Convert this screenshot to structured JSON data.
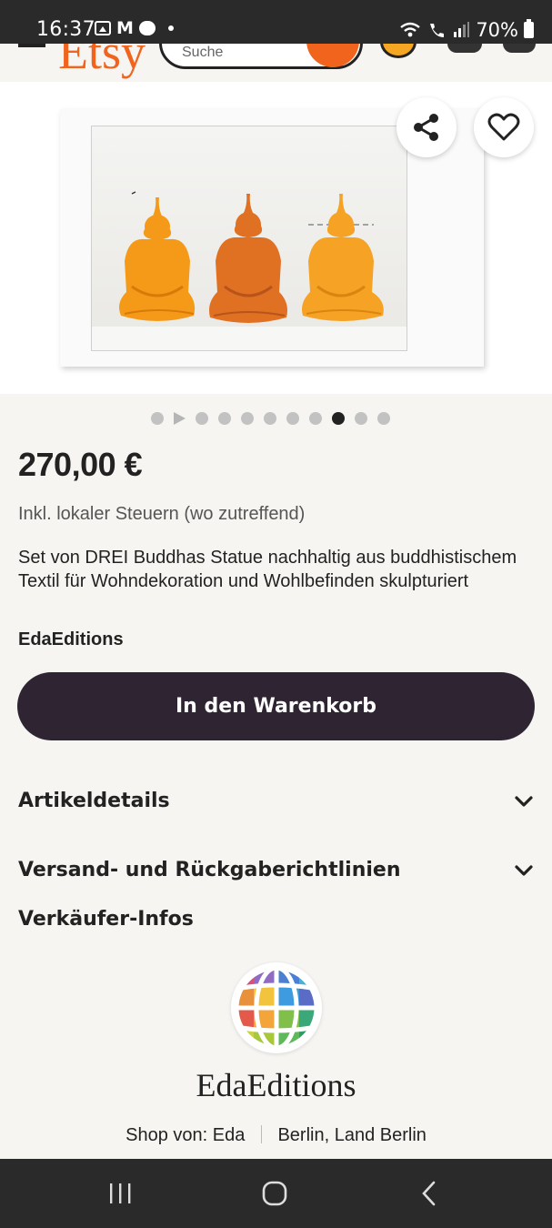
{
  "status_bar": {
    "time": "16:37",
    "battery": "70%"
  },
  "header": {
    "logo": "Etsy",
    "search_placeholder": "Suche"
  },
  "gallery": {
    "total_dots": 11,
    "active_index": 8,
    "has_video_marker": true
  },
  "product": {
    "price": "270,00 €",
    "tax_note": "Inkl. lokaler Steuern (wo zutreffend)",
    "title": "Set von DREI Buddhas Statue nachhaltig aus buddhistischem Textil für Wohndekoration und Wohlbefinden skulpturiert",
    "shop": "EdaEditions"
  },
  "actions": {
    "add_to_cart": "In den Warenkorb"
  },
  "sections": {
    "details": "Artikeldetails",
    "shipping": "Versand- und Rückgaberichtlinien",
    "seller": "Verkäufer-Infos"
  },
  "seller": {
    "shop_name": "EdaEditions",
    "owner": "Shop von: Eda",
    "location": "Berlin, Land Berlin"
  },
  "colors": {
    "accent": "#f1641e",
    "button": "#2f2532",
    "background": "#f7f5f2"
  }
}
